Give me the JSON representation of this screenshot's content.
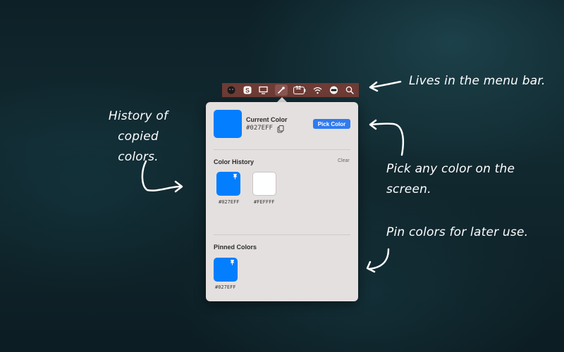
{
  "callouts": {
    "menu_bar": "Lives in the menu bar.",
    "history_line1": "History of copied",
    "history_line2": "colors.",
    "pick_line1": "Pick any color on the",
    "pick_line2": "screen.",
    "pin": "Pin colors for later use."
  },
  "menubar": {
    "icons": [
      "face-icon",
      "s-app-icon",
      "display-icon",
      "eyedropper-icon",
      "battery-icon",
      "wifi-icon",
      "toggle-icon",
      "search-icon"
    ],
    "battery_text": "52"
  },
  "popover": {
    "current_color_label": "Current Color",
    "current_color_hex": "#027EFF",
    "current_color": "#027EFF",
    "pick_button": "Pick Color",
    "history_title": "Color History",
    "clear_label": "Clear",
    "history": [
      {
        "hex": "#027EFF",
        "color": "#027EFF",
        "pinned": true
      },
      {
        "hex": "#FEFFFF",
        "color": "#FEFFFF",
        "pinned": false
      }
    ],
    "pinned_title": "Pinned Colors",
    "pinned": [
      {
        "hex": "#027EFF",
        "color": "#027EFF"
      }
    ]
  }
}
